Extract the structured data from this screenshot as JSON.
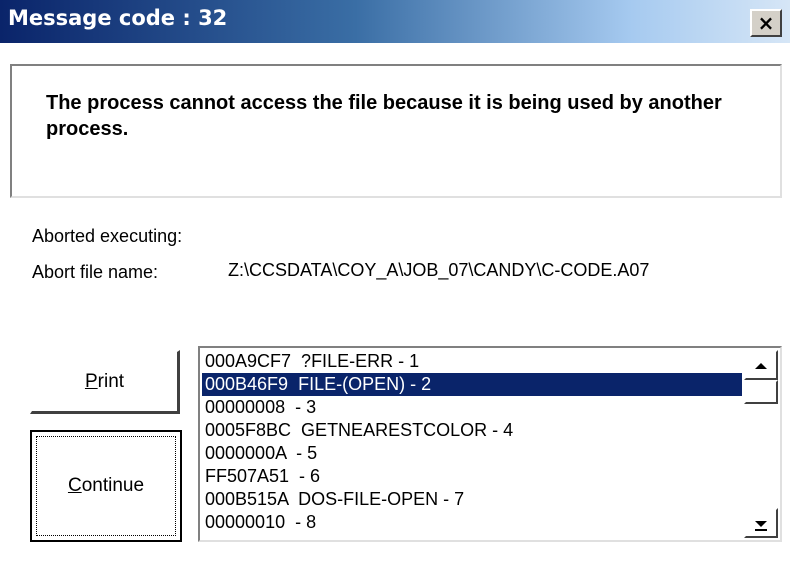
{
  "window": {
    "title": "Message code : 32",
    "close_glyph": "×"
  },
  "message": {
    "text": "The process cannot access the file because it is being used by another process."
  },
  "details": {
    "aborted_label": "Aborted executing:",
    "abort_file_label": "Abort file name:",
    "abort_file_value": "Z:\\CCSDATA\\COY_A\\JOB_07\\CANDY\\C-CODE.A07"
  },
  "buttons": {
    "print_mnemonic": "P",
    "print_rest": "rint",
    "continue_mnemonic": "C",
    "continue_rest": "ontinue"
  },
  "stack_list": {
    "selected_index": 1,
    "items": [
      "000A9CF7  ?FILE-ERR - 1",
      "000B46F9  FILE-(OPEN) - 2",
      "00000008  - 3",
      "0005F8BC  GETNEARESTCOLOR - 4",
      "0000000A  - 5",
      "FF507A51  - 6",
      "000B515A  DOS-FILE-OPEN - 7",
      "00000010  - 8"
    ]
  },
  "colors": {
    "title_gradient_start": "#0a246a",
    "selection": "#0a246a"
  }
}
